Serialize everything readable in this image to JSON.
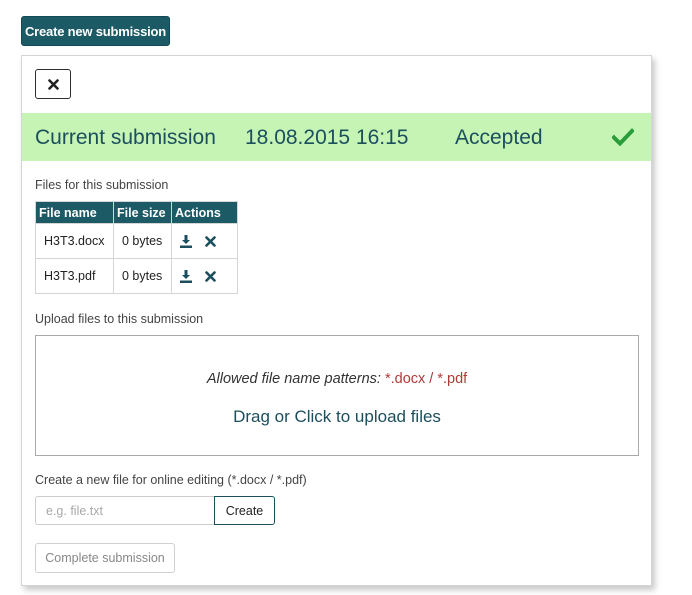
{
  "toolbar": {
    "create_label": "Create new submission"
  },
  "panel": {
    "close_icon": "close-icon",
    "status": {
      "label": "Current submission",
      "date": "18.08.2015 16:15",
      "state": "Accepted",
      "state_icon": "checkmark-icon",
      "background": "#c5f4b5",
      "text_color": "#1c4f5e",
      "check_color": "#2a9d3a"
    },
    "files_label": "Files for this submission",
    "files_table": {
      "headers": [
        "File name",
        "File size",
        "Actions"
      ],
      "header_bg": "#1c5a66",
      "rows": [
        {
          "name": "H3T3.docx",
          "size": "0 bytes",
          "actions": [
            "download-icon",
            "delete-icon"
          ]
        },
        {
          "name": "H3T3.pdf",
          "size": "0 bytes",
          "actions": [
            "download-icon",
            "delete-icon"
          ]
        }
      ]
    },
    "upload": {
      "label": "Upload files to this submission",
      "patterns_prefix": "Allowed file name patterns: ",
      "patterns": "*.docx / *.pdf",
      "pattern_color": "#b03a3a",
      "drop_text": "Drag or Click to upload files"
    },
    "new_file": {
      "label": "Create a new file for online editing (*.docx / *.pdf)",
      "placeholder": "e.g. file.txt",
      "value": "",
      "create_label": "Create"
    },
    "complete_label": "Complete submission"
  }
}
